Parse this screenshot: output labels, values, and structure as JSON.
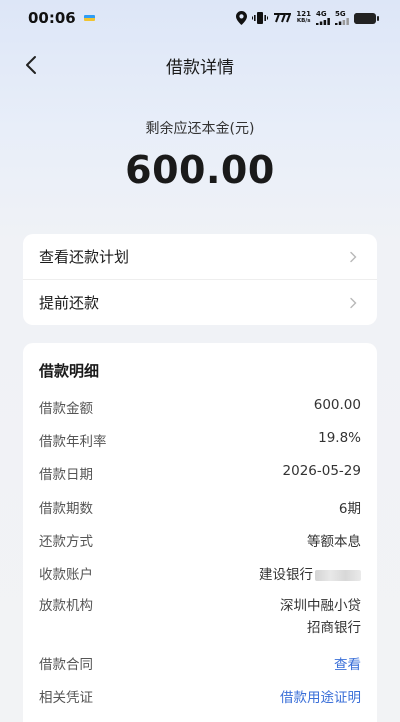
{
  "status_bar": {
    "time": "00:06",
    "net_speed_top": "121",
    "net_speed_unit": "KB/s",
    "signal_1": "4G",
    "signal_2": "5G",
    "battery_level": 0.7
  },
  "nav": {
    "title": "借款详情"
  },
  "summary": {
    "label": "剩余应还本金(元)",
    "amount": "600.00"
  },
  "actions": [
    {
      "label": "查看还款计划"
    },
    {
      "label": "提前还款"
    }
  ],
  "details": {
    "title": "借款明细",
    "rows": [
      {
        "label": "借款金额",
        "value": "600.00"
      },
      {
        "label": "借款年利率",
        "value": "19.8%"
      },
      {
        "label": "借款日期",
        "value": "2026-05-29"
      },
      {
        "label": "借款期数",
        "value": "6期"
      },
      {
        "label": "还款方式",
        "value": "等额本息"
      },
      {
        "label": "收款账户",
        "value": "建设银行"
      },
      {
        "label": "放款机构",
        "value_line1": "深圳中融小贷",
        "value_line2": "招商银行"
      },
      {
        "label": "借款合同",
        "value": "查看"
      },
      {
        "label": "相关凭证",
        "value": "借款用途证明"
      }
    ]
  },
  "colors": {
    "link": "#3a6fd8",
    "header_gradient_top": "#dde6f7",
    "page_background": "#f2f3f5"
  }
}
